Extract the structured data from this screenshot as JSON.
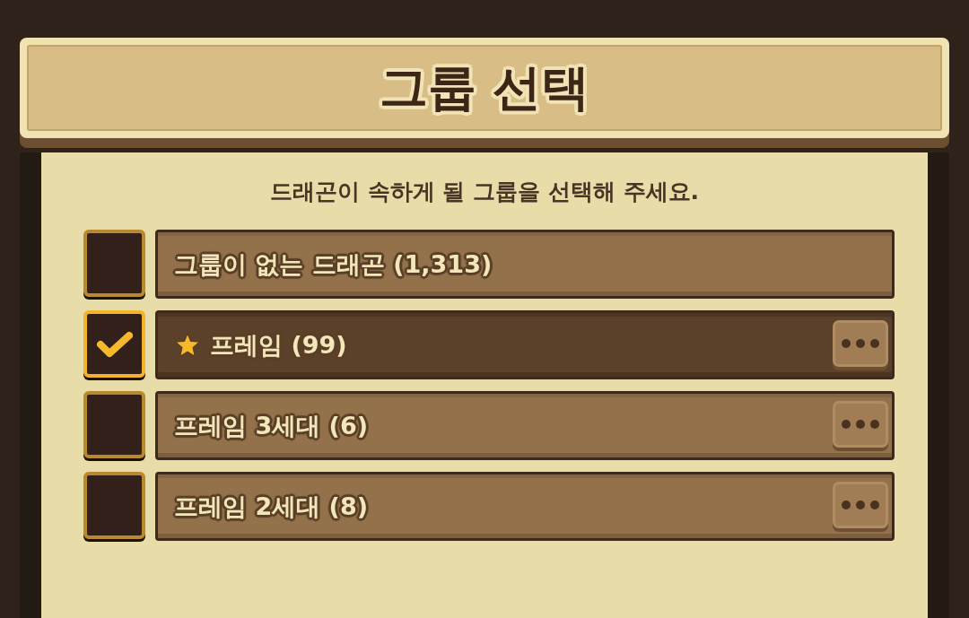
{
  "dialog": {
    "title": "그룹 선택",
    "instruction": "드래곤이 속하게 될 그룹을 선택해 주세요."
  },
  "groups": [
    {
      "label": "그룹이 없는 드래곤 (1,313)",
      "checked": false,
      "selected": false,
      "starred": false,
      "menu": false
    },
    {
      "label": "프레임 (99)",
      "checked": true,
      "selected": true,
      "starred": true,
      "menu": true
    },
    {
      "label": "프레임 3세대 (6)",
      "checked": false,
      "selected": false,
      "starred": false,
      "menu": true
    },
    {
      "label": "프레임 2세대 (8)",
      "checked": false,
      "selected": false,
      "starred": false,
      "menu": true
    }
  ]
}
